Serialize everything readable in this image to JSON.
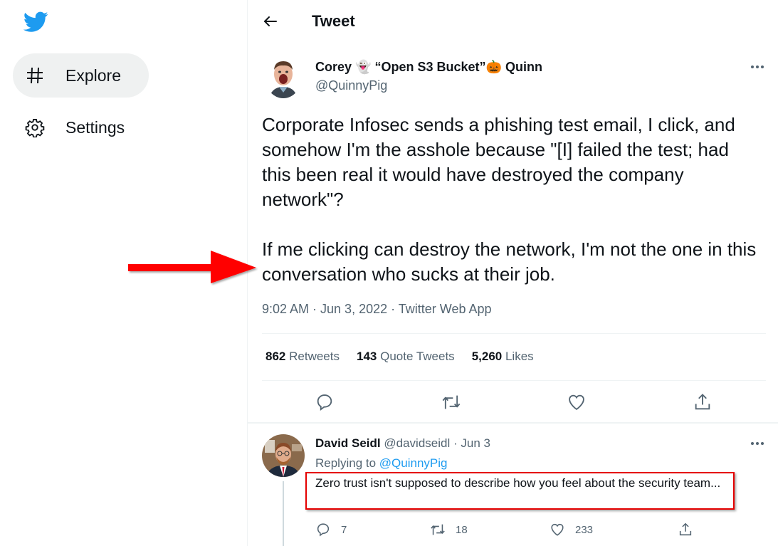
{
  "sidebar": {
    "logo": "twitter-bird-icon",
    "items": [
      {
        "label": "Explore",
        "icon": "hashtag-icon",
        "active": true
      },
      {
        "label": "Settings",
        "icon": "gear-icon",
        "active": false
      }
    ]
  },
  "header": {
    "back_icon": "arrow-left-icon",
    "title": "Tweet"
  },
  "tweet": {
    "author": {
      "name_part1": "Corey",
      "ghost_emoji": "👻",
      "name_part2": "“Open S3 Bucket”",
      "pumpkin_emoji": "🎃",
      "name_part3": "Quinn",
      "handle": "@QuinnyPig"
    },
    "paragraphs": [
      "Corporate Infosec sends a phishing test email, I click, and somehow I'm the asshole because \"[I] failed the test; had this been real it would have destroyed the company network\"?",
      "If me clicking can destroy the network, I'm not the one in this conversation who sucks at their job."
    ],
    "meta": "9:02 AM · Jun 3, 2022 · Twitter Web App",
    "stats": {
      "retweets_count": "862",
      "retweets_label": "Retweets",
      "quotes_count": "143",
      "quotes_label": "Quote Tweets",
      "likes_count": "5,260",
      "likes_label": "Likes"
    },
    "actions": [
      "reply-icon",
      "retweet-icon",
      "like-icon",
      "share-icon"
    ]
  },
  "reply": {
    "name": "David Seidl",
    "handle": "@davidseidl",
    "sep": "·",
    "date": "Jun 3",
    "replying_prefix": "Replying to",
    "replying_to": "@QuinnyPig",
    "text": "Zero trust isn't supposed to describe how you feel about the security team...",
    "reply_count": "7",
    "retweet_count": "18",
    "like_count": "233"
  },
  "annotations": {
    "arrow_color": "#ff0000",
    "box_color": "#e50000"
  },
  "colors": {
    "brand": "#1d9bf0",
    "text": "#0f1419",
    "secondary": "#536471"
  }
}
